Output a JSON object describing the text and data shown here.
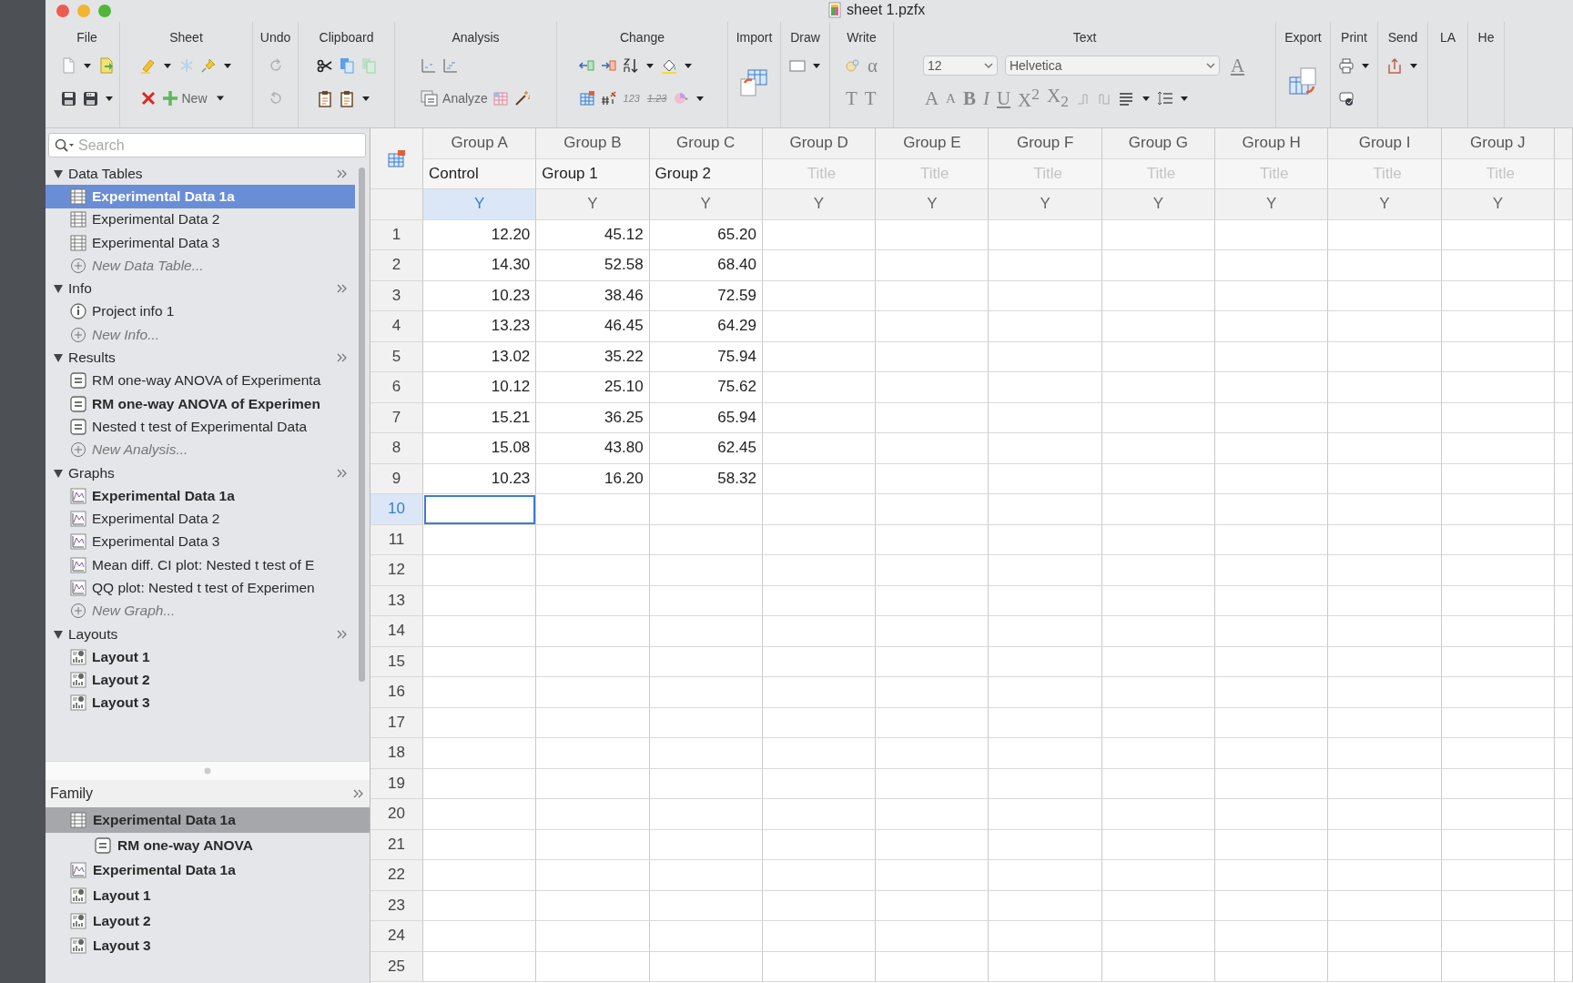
{
  "window": {
    "title": "sheet 1.pzfx"
  },
  "toolbar": [
    {
      "label": "File"
    },
    {
      "label": "Sheet",
      "controls": [
        {
          "kind": "button",
          "label": "New"
        }
      ]
    },
    {
      "label": "Undo"
    },
    {
      "label": "Clipboard"
    },
    {
      "label": "Analysis",
      "controls": [
        {
          "kind": "button",
          "label": "Analyze"
        }
      ]
    },
    {
      "label": "Change",
      "controls": [
        {
          "kind": "glyph",
          "label": "123"
        },
        {
          "kind": "glyph",
          "label": "1.23"
        }
      ]
    },
    {
      "label": "Import"
    },
    {
      "label": "Draw"
    },
    {
      "label": "Write",
      "controls": [
        {
          "kind": "glyph",
          "label": "α"
        },
        {
          "kind": "glyph",
          "label": "T"
        },
        {
          "kind": "glyph",
          "label": "T"
        }
      ]
    },
    {
      "label": "Text",
      "controls": [
        {
          "kind": "select",
          "label": "12"
        },
        {
          "kind": "select",
          "label": "Helvetica"
        },
        {
          "kind": "glyph",
          "label": "A"
        },
        {
          "kind": "glyph",
          "label": "A"
        },
        {
          "kind": "glyph",
          "label": "A"
        },
        {
          "kind": "glyph",
          "label": "B"
        },
        {
          "kind": "glyph",
          "label": "I"
        },
        {
          "kind": "glyph",
          "label": "U"
        },
        {
          "kind": "glyph",
          "label": "X$^{2}$"
        },
        {
          "kind": "glyph",
          "label": "X$_{2}$"
        }
      ]
    },
    {
      "label": "Export"
    },
    {
      "label": "Print"
    },
    {
      "label": "Send"
    },
    {
      "label": "LA"
    },
    {
      "label": "He"
    }
  ],
  "sidebar": {
    "search": {
      "placeholder": "Search"
    },
    "sections": [
      {
        "title": "Data Tables",
        "expanded": true,
        "items": [
          {
            "kind": "table",
            "label": "Experimental Data 1a",
            "bold": true,
            "selected": true
          },
          {
            "kind": "table",
            "label": "Experimental Data 2",
            "bold": false,
            "selected": false
          },
          {
            "kind": "table",
            "label": "Experimental Data 3",
            "bold": false,
            "selected": false
          },
          {
            "kind": "add",
            "label": "New Data Table...",
            "bold": false,
            "selected": false
          }
        ]
      },
      {
        "title": "Info",
        "expanded": true,
        "items": [
          {
            "kind": "info",
            "label": "Project info 1",
            "bold": false,
            "selected": false
          },
          {
            "kind": "add",
            "label": "New Info...",
            "bold": false,
            "selected": false
          }
        ]
      },
      {
        "title": "Results",
        "expanded": true,
        "items": [
          {
            "kind": "result",
            "label": "RM one-way ANOVA of Experimenta",
            "bold": false,
            "selected": false
          },
          {
            "kind": "result",
            "label": "RM one-way ANOVA of Experimen",
            "bold": true,
            "selected": false
          },
          {
            "kind": "result",
            "label": "Nested t test of Experimental Data",
            "bold": false,
            "selected": false
          },
          {
            "kind": "add",
            "label": "New Analysis...",
            "bold": false,
            "selected": false
          }
        ]
      },
      {
        "title": "Graphs",
        "expanded": true,
        "items": [
          {
            "kind": "graph",
            "label": "Experimental Data 1a",
            "bold": true,
            "selected": false
          },
          {
            "kind": "graph",
            "label": "Experimental Data 2",
            "bold": false,
            "selected": false
          },
          {
            "kind": "graph",
            "label": "Experimental Data 3",
            "bold": false,
            "selected": false
          },
          {
            "kind": "graph",
            "label": "Mean diff. CI plot: Nested t test of E",
            "bold": false,
            "selected": false
          },
          {
            "kind": "graph",
            "label": "QQ plot: Nested t test of Experimen",
            "bold": false,
            "selected": false
          },
          {
            "kind": "add",
            "label": "New Graph...",
            "bold": false,
            "selected": false
          }
        ]
      },
      {
        "title": "Layouts",
        "expanded": true,
        "items": [
          {
            "kind": "layout",
            "label": "Layout 1",
            "bold": true,
            "selected": false
          },
          {
            "kind": "layout",
            "label": "Layout 2",
            "bold": true,
            "selected": false
          },
          {
            "kind": "layout",
            "label": "Layout 3",
            "bold": true,
            "selected": false
          }
        ]
      }
    ]
  },
  "family": {
    "title": "Family",
    "items": [
      {
        "kind": "table",
        "label": "Experimental Data 1a",
        "selected": true,
        "children": [
          {
            "kind": "result",
            "label": "RM one-way ANOVA",
            "selected": false
          }
        ]
      },
      {
        "kind": "graph",
        "label": "Experimental Data 1a",
        "selected": false
      },
      {
        "kind": "layout",
        "label": "Layout 1",
        "selected": false
      },
      {
        "kind": "layout",
        "label": "Layout 2",
        "selected": false
      },
      {
        "kind": "layout",
        "label": "Layout 3",
        "selected": false
      }
    ]
  },
  "sheet": {
    "columns": [
      {
        "group": "Group A",
        "title": "Control",
        "subcolumn": "Y",
        "selected": true
      },
      {
        "group": "Group B",
        "title": "Group 1",
        "subcolumn": "Y",
        "selected": false
      },
      {
        "group": "Group C",
        "title": "Group 2",
        "subcolumn": "Y",
        "selected": false
      },
      {
        "group": "Group D",
        "placeholder": "Title",
        "subcolumn": "Y",
        "selected": false
      },
      {
        "group": "Group E",
        "placeholder": "Title",
        "subcolumn": "Y",
        "selected": false
      },
      {
        "group": "Group F",
        "placeholder": "Title",
        "subcolumn": "Y",
        "selected": false
      },
      {
        "group": "Group G",
        "placeholder": "Title",
        "subcolumn": "Y",
        "selected": false
      },
      {
        "group": "Group H",
        "placeholder": "Title",
        "subcolumn": "Y",
        "selected": false
      },
      {
        "group": "Group I",
        "placeholder": "Title",
        "subcolumn": "Y",
        "selected": false
      },
      {
        "group": "Group J",
        "placeholder": "Title",
        "subcolumn": "Y",
        "selected": false
      }
    ],
    "rows": [
      {
        "number": "1",
        "active": false,
        "cells": [
          "12.20",
          "45.12",
          "65.20"
        ]
      },
      {
        "number": "2",
        "active": false,
        "cells": [
          "14.30",
          "52.58",
          "68.40"
        ]
      },
      {
        "number": "3",
        "active": false,
        "cells": [
          "10.23",
          "38.46",
          "72.59"
        ]
      },
      {
        "number": "4",
        "active": false,
        "cells": [
          "13.23",
          "46.45",
          "64.29"
        ]
      },
      {
        "number": "5",
        "active": false,
        "cells": [
          "13.02",
          "35.22",
          "75.94"
        ]
      },
      {
        "number": "6",
        "active": false,
        "cells": [
          "10.12",
          "25.10",
          "75.62"
        ]
      },
      {
        "number": "7",
        "active": false,
        "cells": [
          "15.21",
          "36.25",
          "65.94"
        ]
      },
      {
        "number": "8",
        "active": false,
        "cells": [
          "15.08",
          "43.80",
          "62.45"
        ]
      },
      {
        "number": "9",
        "active": false,
        "cells": [
          "10.23",
          "16.20",
          "58.32"
        ]
      },
      {
        "number": "10",
        "active": true,
        "cells": []
      },
      {
        "number": "11",
        "active": false,
        "cells": []
      },
      {
        "number": "12",
        "active": false,
        "cells": []
      },
      {
        "number": "13",
        "active": false,
        "cells": []
      },
      {
        "number": "14",
        "active": false,
        "cells": []
      },
      {
        "number": "15",
        "active": false,
        "cells": []
      },
      {
        "number": "16",
        "active": false,
        "cells": []
      },
      {
        "number": "17",
        "active": false,
        "cells": []
      },
      {
        "number": "18",
        "active": false,
        "cells": []
      },
      {
        "number": "19",
        "active": false,
        "cells": []
      },
      {
        "number": "20",
        "active": false,
        "cells": []
      },
      {
        "number": "21",
        "active": false,
        "cells": []
      },
      {
        "number": "22",
        "active": false,
        "cells": []
      },
      {
        "number": "23",
        "active": false,
        "cells": []
      },
      {
        "number": "24",
        "active": false,
        "cells": []
      },
      {
        "number": "25",
        "active": false,
        "cells": []
      }
    ]
  }
}
